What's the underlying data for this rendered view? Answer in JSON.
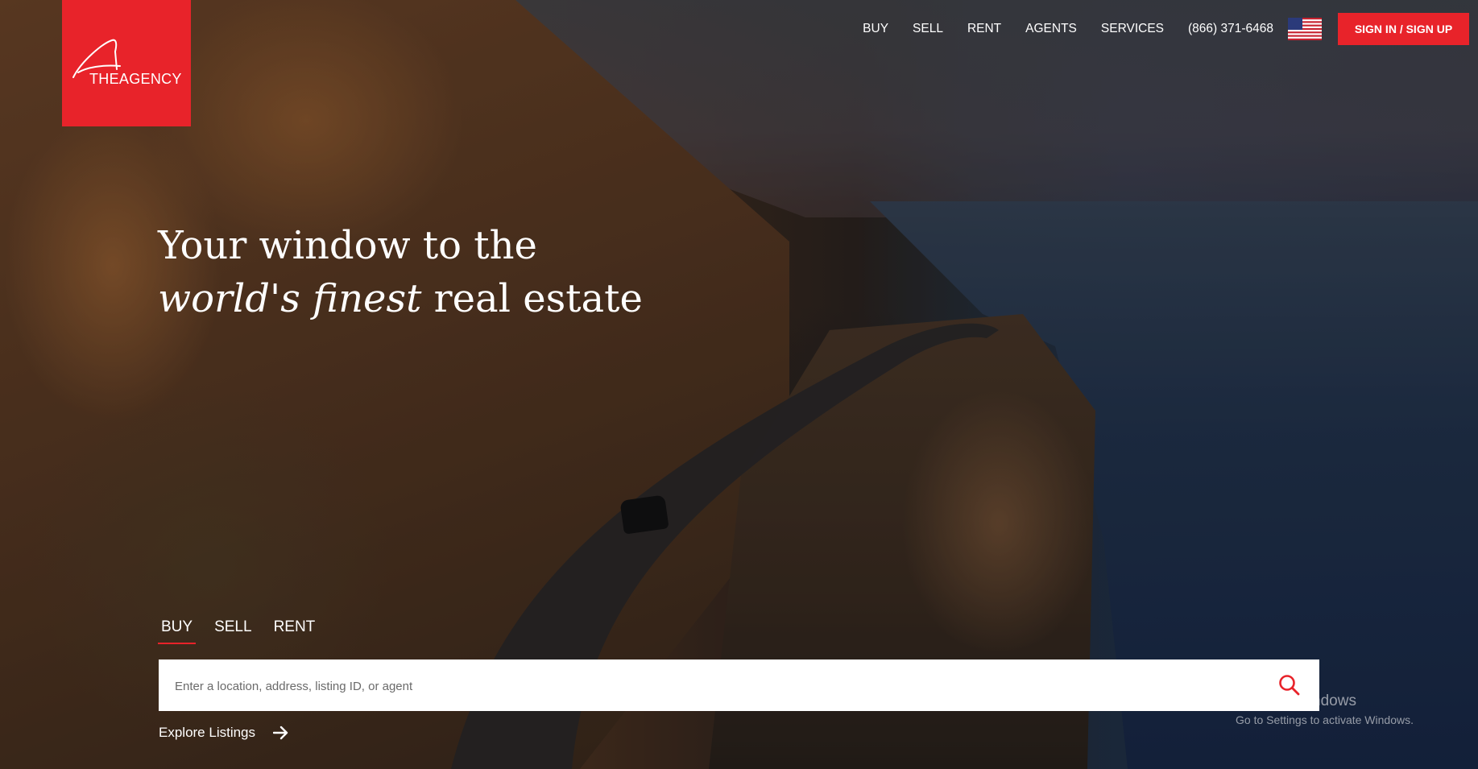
{
  "brand": {
    "logo_text": "THEAGENCY"
  },
  "nav": {
    "items": [
      {
        "label": "BUY"
      },
      {
        "label": "SELL"
      },
      {
        "label": "RENT"
      },
      {
        "label": "AGENTS"
      },
      {
        "label": "SERVICES"
      }
    ],
    "phone": "(866) 371-6468",
    "flag_icon": "us-flag-icon",
    "signin_label": "SIGN IN / SIGN UP"
  },
  "hero": {
    "headline_line1": "Your window to the",
    "headline_italic1": "world's",
    "headline_italic2": "finest",
    "headline_rest": "real estate"
  },
  "search": {
    "tabs": [
      {
        "label": "BUY",
        "active": true
      },
      {
        "label": "SELL",
        "active": false
      },
      {
        "label": "RENT",
        "active": false
      }
    ],
    "placeholder": "Enter a location, address, listing ID, or agent",
    "value": "",
    "icon": "search-icon"
  },
  "explore_label": "Explore Listings",
  "watermark": {
    "title": "Activate Windows",
    "subtitle": "Go to Settings to activate Windows."
  },
  "colors": {
    "accent": "#e8232a",
    "white": "#ffffff"
  }
}
